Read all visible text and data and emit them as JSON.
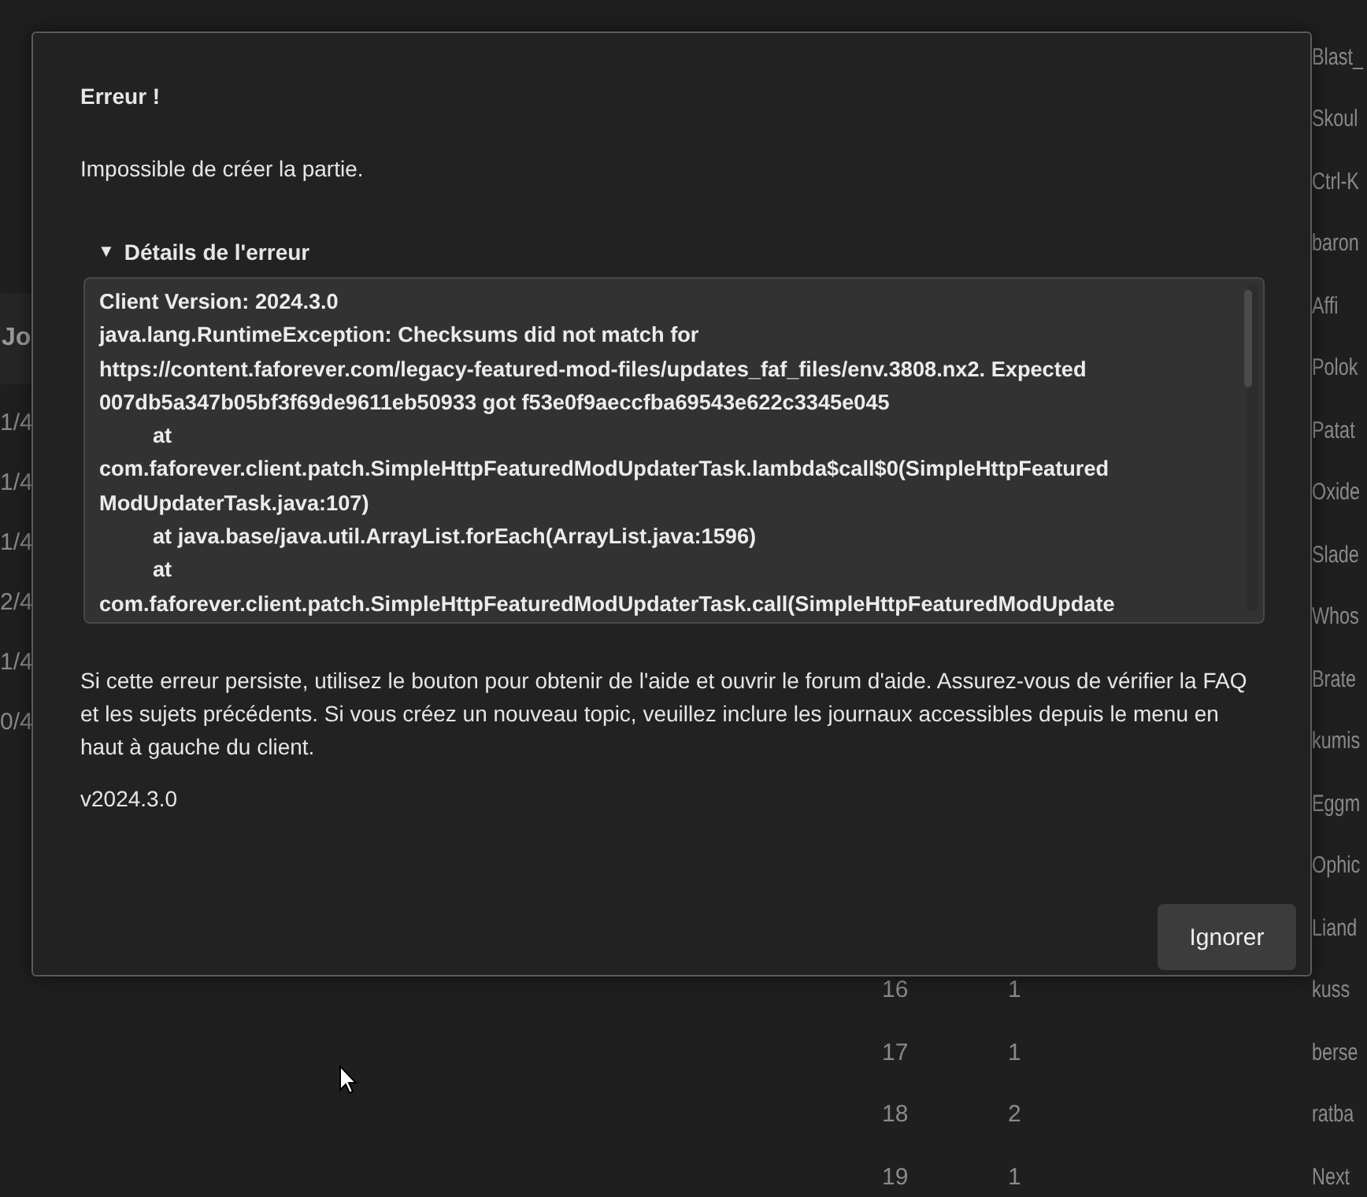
{
  "background": {
    "left_table": {
      "header": "Jo",
      "rows": [
        "1/4",
        "1/4",
        "1/4",
        "2/4",
        "1/4",
        "0/4"
      ]
    },
    "right_table": {
      "rows": [
        {
          "name": "Blast_"
        },
        {
          "name": "Skoul"
        },
        {
          "name": "Ctrl-K"
        },
        {
          "name": "baron"
        },
        {
          "name": "Affi"
        },
        {
          "name": "Polok"
        },
        {
          "name": "Patat"
        },
        {
          "name": "Oxide"
        },
        {
          "name": "Slade"
        },
        {
          "name": "Whos"
        },
        {
          "name": "Brate"
        },
        {
          "name": "kumis"
        },
        {
          "name": "Eggm"
        },
        {
          "name": "Ophic"
        },
        {
          "name": "Liand"
        },
        {
          "rank": "16",
          "count": "1",
          "name": "kuss"
        },
        {
          "rank": "17",
          "count": "1",
          "name": "berse"
        },
        {
          "rank": "18",
          "count": "2",
          "name": "ratba"
        },
        {
          "rank": "19",
          "count": "1",
          "name": "Next"
        }
      ]
    }
  },
  "dialog": {
    "title": "Erreur !",
    "message": "Impossible de créer la partie.",
    "details": {
      "label": "Détails de l'erreur",
      "expanded": true,
      "icon": "▼",
      "lines": [
        {
          "text": "Client Version: 2024.3.0",
          "indented": false
        },
        {
          "text": "java.lang.RuntimeException: Checksums did not match for",
          "indented": false
        },
        {
          "text": "https://content.faforever.com/legacy-featured-mod-files/updates_faf_files/env.3808.nx2. Expected",
          "indented": false
        },
        {
          "text": "007db5a347b05bf3f69de9611eb50933 got f53e0f9aeccfba69543e622c3345e045",
          "indented": false
        },
        {
          "text": "at",
          "indented": true
        },
        {
          "text": "com.faforever.client.patch.SimpleHttpFeaturedModUpdaterTask.lambda$call$0(SimpleHttpFeatured",
          "indented": false
        },
        {
          "text": "ModUpdaterTask.java:107)",
          "indented": false
        },
        {
          "text": "at java.base/java.util.ArrayList.forEach(ArrayList.java:1596)",
          "indented": true
        },
        {
          "text": "at",
          "indented": true
        },
        {
          "text": "com.faforever.client.patch.SimpleHttpFeaturedModUpdaterTask.call(SimpleHttpFeaturedModUpdate",
          "indented": false
        }
      ]
    },
    "help": "Si cette erreur persiste, utilisez le bouton pour obtenir de l'aide et ouvrir le forum d'aide. Assurez-vous de vérifier la FAQ et les sujets précédents. Si vous créez un nouveau topic, veuillez inclure les journaux accessibles depuis le menu en haut à gauche du client.",
    "version": "v2024.3.0",
    "buttons": [
      "Ignorer"
    ]
  }
}
